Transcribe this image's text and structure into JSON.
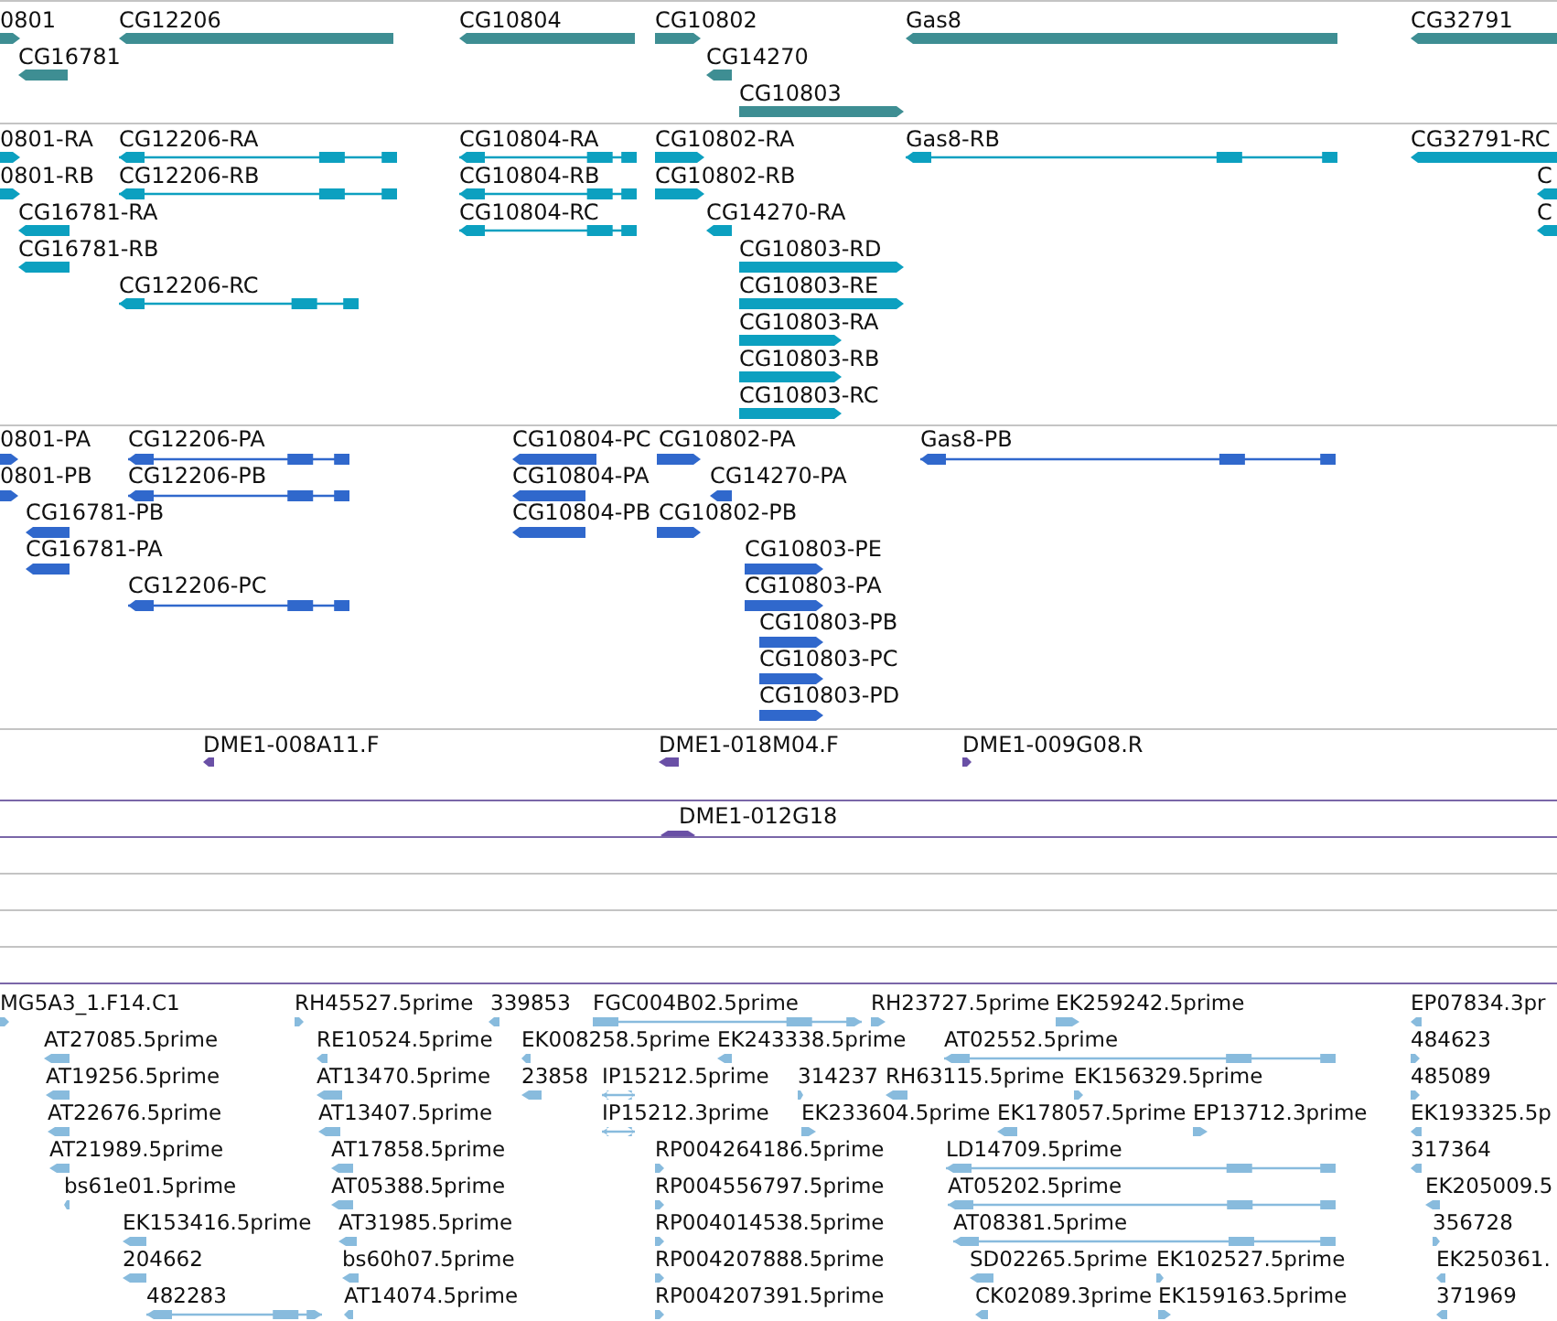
{
  "tracks": [
    {
      "kind": "gene",
      "features": [
        {
          "label": "0801",
          "kind": "forward"
        },
        {
          "label": "CG12206",
          "kind": "reverse"
        },
        {
          "label": "CG16781",
          "kind": "reverse"
        },
        {
          "label": "CG10804",
          "kind": "reverse"
        },
        {
          "label": "CG10802",
          "kind": "forward"
        },
        {
          "label": "CG14270",
          "kind": "reverse"
        },
        {
          "label": "CG10803",
          "kind": "forward"
        },
        {
          "label": "Gas8",
          "kind": "reverse"
        },
        {
          "label": "CG32791",
          "kind": "reverse"
        }
      ]
    },
    {
      "kind": "transcript",
      "features": [
        {
          "label": "0801-RA",
          "kind": "forward"
        },
        {
          "label": "0801-RB",
          "kind": "forward"
        },
        {
          "label": "CG12206-RA",
          "kind": "reverse"
        },
        {
          "label": "CG12206-RB",
          "kind": "reverse"
        },
        {
          "label": "CG16781-RA",
          "kind": "reverse"
        },
        {
          "label": "CG16781-RB",
          "kind": "reverse"
        },
        {
          "label": "CG12206-RC",
          "kind": "reverse"
        },
        {
          "label": "CG10804-RA",
          "kind": "reverse"
        },
        {
          "label": "CG10804-RB",
          "kind": "reverse"
        },
        {
          "label": "CG10804-RC",
          "kind": "reverse"
        },
        {
          "label": "CG10802-RA",
          "kind": "forward"
        },
        {
          "label": "CG10802-RB",
          "kind": "forward"
        },
        {
          "label": "CG14270-RA",
          "kind": "reverse"
        },
        {
          "label": "CG10803-RD",
          "kind": "forward"
        },
        {
          "label": "CG10803-RE",
          "kind": "forward"
        },
        {
          "label": "CG10803-RA",
          "kind": "forward"
        },
        {
          "label": "CG10803-RB",
          "kind": "forward"
        },
        {
          "label": "CG10803-RC",
          "kind": "forward"
        },
        {
          "label": "Gas8-RB",
          "kind": "reverse"
        },
        {
          "label": "CG32791-RC",
          "kind": "reverse"
        },
        {
          "label": "C",
          "kind": "reverse"
        },
        {
          "label": "C",
          "kind": "reverse"
        }
      ]
    },
    {
      "kind": "protein",
      "features": [
        {
          "label": "0801-PA",
          "kind": "forward"
        },
        {
          "label": "0801-PB",
          "kind": "forward"
        },
        {
          "label": "CG12206-PA",
          "kind": "reverse"
        },
        {
          "label": "CG12206-PB",
          "kind": "reverse"
        },
        {
          "label": "CG16781-PB",
          "kind": "reverse"
        },
        {
          "label": "CG16781-PA",
          "kind": "reverse"
        },
        {
          "label": "CG12206-PC",
          "kind": "reverse"
        },
        {
          "label": "CG10804-PC",
          "kind": "reverse"
        },
        {
          "label": "CG10804-PA",
          "kind": "reverse"
        },
        {
          "label": "CG10804-PB",
          "kind": "reverse"
        },
        {
          "label": "CG10802-PA",
          "kind": "forward"
        },
        {
          "label": "CG14270-PA",
          "kind": "reverse"
        },
        {
          "label": "CG10802-PB",
          "kind": "forward"
        },
        {
          "label": "CG10803-PE",
          "kind": "forward"
        },
        {
          "label": "CG10803-PA",
          "kind": "forward"
        },
        {
          "label": "CG10803-PB",
          "kind": "forward"
        },
        {
          "label": "CG10803-PC",
          "kind": "forward"
        },
        {
          "label": "CG10803-PD",
          "kind": "forward"
        },
        {
          "label": "Gas8-PB",
          "kind": "reverse"
        }
      ]
    },
    {
      "kind": "end_read",
      "features": [
        {
          "label": "DME1-008A11.F",
          "kind": "reverse"
        },
        {
          "label": "DME1-018M04.F",
          "kind": "reverse"
        },
        {
          "label": "DME1-009G08.R",
          "kind": "forward"
        }
      ]
    },
    {
      "kind": "clone",
      "features": [
        {
          "label": "DME1-012G18",
          "kind": "both"
        }
      ]
    },
    {
      "kind": "cdna",
      "features": [
        {
          "label": "MG5A3_1.F14.C1",
          "kind": "forward"
        },
        {
          "label": "RH45527.5prime",
          "kind": "forward"
        },
        {
          "label": "339853",
          "kind": "reverse"
        },
        {
          "label": "FGC004B02.5prime",
          "kind": "forward"
        },
        {
          "label": "RH23727.5prime",
          "kind": "forward"
        },
        {
          "label": "EK259242.5prime",
          "kind": "forward"
        },
        {
          "label": "EP07834.3pr",
          "kind": "reverse"
        },
        {
          "label": "AT27085.5prime",
          "kind": "reverse"
        },
        {
          "label": "RE10524.5prime",
          "kind": "reverse"
        },
        {
          "label": "EK008258.5prime",
          "kind": "reverse"
        },
        {
          "label": "EK243338.5prime",
          "kind": "reverse"
        },
        {
          "label": "AT02552.5prime",
          "kind": "reverse"
        },
        {
          "label": "484623",
          "kind": "forward"
        },
        {
          "label": "AT19256.5prime",
          "kind": "reverse"
        },
        {
          "label": "AT13470.5prime",
          "kind": "reverse"
        },
        {
          "label": "23858",
          "kind": "reverse"
        },
        {
          "label": "IP15212.5prime",
          "kind": "both"
        },
        {
          "label": "314237",
          "kind": "forward"
        },
        {
          "label": "RH63115.5prime",
          "kind": "reverse"
        },
        {
          "label": "EK156329.5prime",
          "kind": "forward"
        },
        {
          "label": "485089",
          "kind": "forward"
        },
        {
          "label": "AT22676.5prime",
          "kind": "reverse"
        },
        {
          "label": "AT13407.5prime",
          "kind": "reverse"
        },
        {
          "label": "IP15212.3prime",
          "kind": "both"
        },
        {
          "label": "EK233604.5prime",
          "kind": "forward"
        },
        {
          "label": "EK178057.5prime",
          "kind": "reverse"
        },
        {
          "label": "EP13712.3prime",
          "kind": "forward"
        },
        {
          "label": "EK193325.5p",
          "kind": "reverse"
        },
        {
          "label": "AT21989.5prime",
          "kind": "reverse"
        },
        {
          "label": "AT17858.5prime",
          "kind": "reverse"
        },
        {
          "label": "RP004264186.5prime",
          "kind": "forward"
        },
        {
          "label": "LD14709.5prime",
          "kind": "reverse"
        },
        {
          "label": "317364",
          "kind": "reverse"
        },
        {
          "label": "bs61e01.5prime",
          "kind": "reverse"
        },
        {
          "label": "AT05388.5prime",
          "kind": "reverse"
        },
        {
          "label": "RP004556797.5prime",
          "kind": "forward"
        },
        {
          "label": "AT05202.5prime",
          "kind": "reverse"
        },
        {
          "label": "EK205009.5",
          "kind": "reverse"
        },
        {
          "label": "EK153416.5prime",
          "kind": "reverse"
        },
        {
          "label": "AT31985.5prime",
          "kind": "reverse"
        },
        {
          "label": "RP004014538.5prime",
          "kind": "forward"
        },
        {
          "label": "AT08381.5prime",
          "kind": "reverse"
        },
        {
          "label": "356728",
          "kind": "forward"
        },
        {
          "label": "204662",
          "kind": "reverse"
        },
        {
          "label": "bs60h07.5prime",
          "kind": "reverse"
        },
        {
          "label": "RP004207888.5prime",
          "kind": "forward"
        },
        {
          "label": "SD02265.5prime",
          "kind": "reverse"
        },
        {
          "label": "EK102527.5prime",
          "kind": "forward"
        },
        {
          "label": "EK250361.",
          "kind": "reverse"
        },
        {
          "label": "482283",
          "kind": "both"
        },
        {
          "label": "AT14074.5prime",
          "kind": "reverse"
        },
        {
          "label": "RP004207391.5prime",
          "kind": "forward"
        },
        {
          "label": "CK02089.3prime",
          "kind": "reverse"
        },
        {
          "label": "EK159163.5prime",
          "kind": "forward"
        },
        {
          "label": "371969",
          "kind": "reverse"
        }
      ]
    }
  ]
}
